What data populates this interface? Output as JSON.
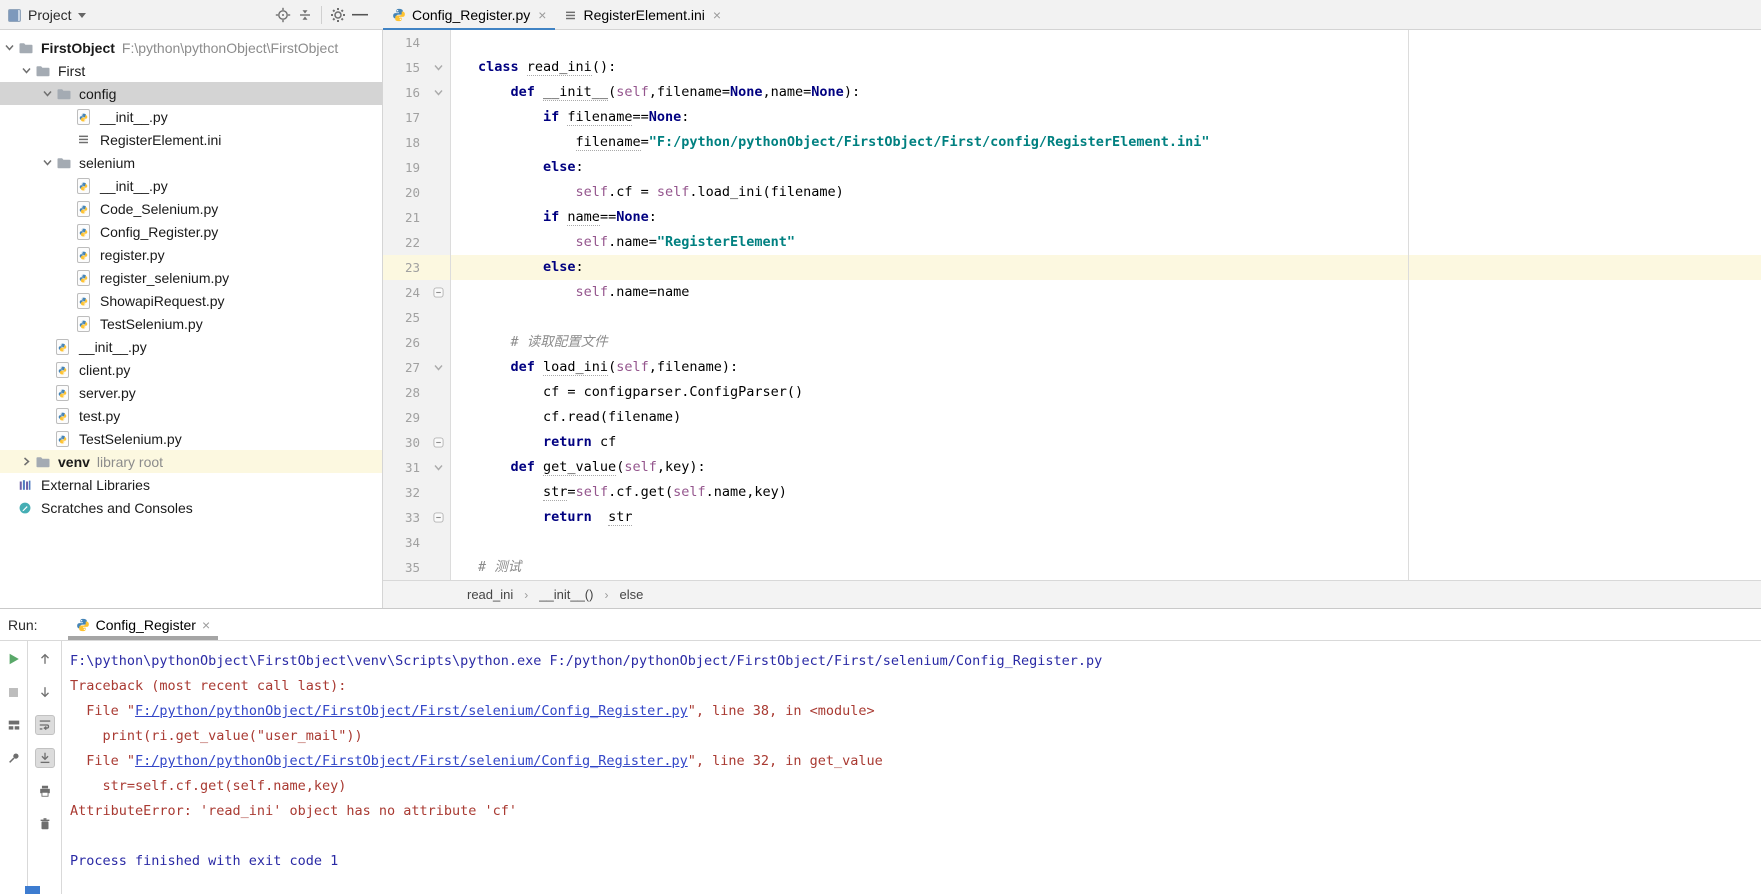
{
  "project_panel": {
    "title": "Project",
    "toolbar": [
      "locate",
      "collapse-all",
      "settings",
      "hide"
    ],
    "tree": [
      {
        "label": "FirstObject",
        "note": "F:\\python\\pythonObject\\FirstObject",
        "type": "folder",
        "depth": 0,
        "state": "expanded",
        "bold": true
      },
      {
        "label": "First",
        "type": "folder",
        "depth": 1,
        "state": "expanded"
      },
      {
        "label": "config",
        "type": "folder",
        "depth": 2,
        "state": "expanded",
        "selected": true
      },
      {
        "label": "__init__.py",
        "type": "python",
        "depth": 3
      },
      {
        "label": "RegisterElement.ini",
        "type": "ini",
        "depth": 3
      },
      {
        "label": "selenium",
        "type": "folder",
        "depth": 2,
        "state": "expanded"
      },
      {
        "label": "__init__.py",
        "type": "python",
        "depth": 3
      },
      {
        "label": "Code_Selenium.py",
        "type": "python",
        "depth": 3
      },
      {
        "label": "Config_Register.py",
        "type": "python",
        "depth": 3
      },
      {
        "label": "register.py",
        "type": "python",
        "depth": 3
      },
      {
        "label": "register_selenium.py",
        "type": "python",
        "depth": 3
      },
      {
        "label": "ShowapiRequest.py",
        "type": "python",
        "depth": 3
      },
      {
        "label": "TestSelenium.py",
        "type": "python",
        "depth": 3
      },
      {
        "label": "__init__.py",
        "type": "python",
        "depth": 2
      },
      {
        "label": "client.py",
        "type": "python",
        "depth": 2
      },
      {
        "label": "server.py",
        "type": "python",
        "depth": 2
      },
      {
        "label": "test.py",
        "type": "python",
        "depth": 2
      },
      {
        "label": "TestSelenium.py",
        "type": "python",
        "depth": 2
      },
      {
        "label": "venv",
        "note": "library root",
        "type": "folder",
        "depth": 1,
        "state": "collapsed",
        "bold": true,
        "highlight": true
      },
      {
        "label": "External Libraries",
        "type": "libraries",
        "depth": 0
      },
      {
        "label": "Scratches and Consoles",
        "type": "scratches",
        "depth": 0
      }
    ]
  },
  "editor": {
    "tabs": [
      {
        "label": "Config_Register.py",
        "icon": "python",
        "active": true
      },
      {
        "label": "RegisterElement.ini",
        "icon": "ini",
        "active": false
      }
    ],
    "breadcrumbs": [
      "read_ini",
      "__init__()",
      "else"
    ],
    "lines": [
      {
        "n": 14,
        "segs": []
      },
      {
        "n": 15,
        "fold": "open",
        "segs": [
          {
            "t": "class ",
            "c": "kw"
          },
          {
            "t": "read_ini",
            "c": "pl u"
          },
          {
            "t": "():",
            "c": "pl"
          }
        ]
      },
      {
        "n": 16,
        "fold": "open",
        "segs": [
          {
            "t": "    ",
            "c": "pl"
          },
          {
            "t": "def ",
            "c": "kw"
          },
          {
            "t": "__init__",
            "c": "pl u"
          },
          {
            "t": "(",
            "c": "pl"
          },
          {
            "t": "self",
            "c": "self"
          },
          {
            "t": ",filename=",
            "c": "pl"
          },
          {
            "t": "None",
            "c": "kw"
          },
          {
            "t": ",name=",
            "c": "pl"
          },
          {
            "t": "None",
            "c": "kw"
          },
          {
            "t": "):",
            "c": "pl"
          }
        ]
      },
      {
        "n": 17,
        "segs": [
          {
            "t": "        ",
            "c": "pl"
          },
          {
            "t": "if ",
            "c": "kw"
          },
          {
            "t": "filename",
            "c": "pl u"
          },
          {
            "t": "==",
            "c": "pl"
          },
          {
            "t": "None",
            "c": "kw"
          },
          {
            "t": ":",
            "c": "pl"
          }
        ]
      },
      {
        "n": 18,
        "segs": [
          {
            "t": "            ",
            "c": "pl"
          },
          {
            "t": "filename",
            "c": "pl u"
          },
          {
            "t": "=",
            "c": "pl"
          },
          {
            "t": "\"F:/python/pythonObject/FirstObject/First/config/RegisterElement.ini\"",
            "c": "str"
          }
        ]
      },
      {
        "n": 19,
        "segs": [
          {
            "t": "        ",
            "c": "pl"
          },
          {
            "t": "else",
            "c": "kw"
          },
          {
            "t": ":",
            "c": "pl"
          }
        ]
      },
      {
        "n": 20,
        "segs": [
          {
            "t": "            ",
            "c": "pl"
          },
          {
            "t": "self",
            "c": "self"
          },
          {
            "t": ".cf = ",
            "c": "pl"
          },
          {
            "t": "self",
            "c": "self"
          },
          {
            "t": ".load_ini(filename)",
            "c": "pl"
          }
        ]
      },
      {
        "n": 21,
        "segs": [
          {
            "t": "        ",
            "c": "pl"
          },
          {
            "t": "if ",
            "c": "kw"
          },
          {
            "t": "name",
            "c": "pl u"
          },
          {
            "t": "==",
            "c": "pl"
          },
          {
            "t": "None",
            "c": "kw"
          },
          {
            "t": ":",
            "c": "pl"
          }
        ]
      },
      {
        "n": 22,
        "segs": [
          {
            "t": "            ",
            "c": "pl"
          },
          {
            "t": "self",
            "c": "self"
          },
          {
            "t": ".name=",
            "c": "pl"
          },
          {
            "t": "\"RegisterElement\"",
            "c": "str"
          }
        ]
      },
      {
        "n": 23,
        "current": true,
        "segs": [
          {
            "t": "        ",
            "c": "pl"
          },
          {
            "t": "else",
            "c": "kw"
          },
          {
            "t": ":",
            "c": "pl"
          }
        ]
      },
      {
        "n": 24,
        "fold": "end",
        "segs": [
          {
            "t": "            ",
            "c": "pl"
          },
          {
            "t": "self",
            "c": "self"
          },
          {
            "t": ".name=name",
            "c": "pl"
          }
        ]
      },
      {
        "n": 25,
        "segs": []
      },
      {
        "n": 26,
        "segs": [
          {
            "t": "    ",
            "c": "pl"
          },
          {
            "t": "# 读取配置文件",
            "c": "com"
          }
        ]
      },
      {
        "n": 27,
        "fold": "open",
        "segs": [
          {
            "t": "    ",
            "c": "pl"
          },
          {
            "t": "def ",
            "c": "kw"
          },
          {
            "t": "load_ini",
            "c": "pl u"
          },
          {
            "t": "(",
            "c": "pl"
          },
          {
            "t": "self",
            "c": "self"
          },
          {
            "t": ",filename):",
            "c": "pl"
          }
        ]
      },
      {
        "n": 28,
        "segs": [
          {
            "t": "        cf = configparser.ConfigParser()",
            "c": "pl"
          }
        ]
      },
      {
        "n": 29,
        "segs": [
          {
            "t": "        cf.read(filename)",
            "c": "pl"
          }
        ]
      },
      {
        "n": 30,
        "fold": "end",
        "segs": [
          {
            "t": "        ",
            "c": "pl"
          },
          {
            "t": "return ",
            "c": "kw"
          },
          {
            "t": "cf",
            "c": "pl"
          }
        ]
      },
      {
        "n": 31,
        "fold": "open",
        "segs": [
          {
            "t": "    ",
            "c": "pl"
          },
          {
            "t": "def ",
            "c": "kw"
          },
          {
            "t": "get_value",
            "c": "pl u"
          },
          {
            "t": "(",
            "c": "pl"
          },
          {
            "t": "self",
            "c": "self"
          },
          {
            "t": ",key):",
            "c": "pl"
          }
        ]
      },
      {
        "n": 32,
        "segs": [
          {
            "t": "        ",
            "c": "pl"
          },
          {
            "t": "str",
            "c": "pl u"
          },
          {
            "t": "=",
            "c": "pl"
          },
          {
            "t": "self",
            "c": "self"
          },
          {
            "t": ".cf.get(",
            "c": "pl"
          },
          {
            "t": "self",
            "c": "self"
          },
          {
            "t": ".name,key)",
            "c": "pl"
          }
        ]
      },
      {
        "n": 33,
        "fold": "end",
        "segs": [
          {
            "t": "        ",
            "c": "pl"
          },
          {
            "t": "return",
            "c": "kw"
          },
          {
            "t": "  ",
            "c": "pl"
          },
          {
            "t": "str",
            "c": "pl u"
          }
        ]
      },
      {
        "n": 34,
        "segs": []
      },
      {
        "n": 35,
        "segs": [
          {
            "t": "# 测试",
            "c": "com"
          }
        ]
      }
    ]
  },
  "run_panel": {
    "label": "Run:",
    "tab": {
      "label": "Config_Register",
      "icon": "python"
    },
    "left_toolbar": [
      "rerun",
      "stop",
      "restore-layout",
      "pin"
    ],
    "gutter_toolbar": [
      {
        "name": "up"
      },
      {
        "name": "down"
      },
      {
        "name": "soft-wrap",
        "toggled": true
      },
      {
        "name": "scroll-to-end",
        "toggled": true
      },
      {
        "name": "print"
      },
      {
        "name": "clear"
      }
    ],
    "console": [
      {
        "segs": [
          {
            "t": "F:\\python\\pythonObject\\FirstObject\\venv\\Scripts\\python.exe F:/python/pythonObject/FirstObject/First/selenium/Config_Register.py",
            "c": "out"
          }
        ]
      },
      {
        "segs": [
          {
            "t": "Traceback (most recent call last):",
            "c": "err"
          }
        ]
      },
      {
        "segs": [
          {
            "t": "  File \"",
            "c": "err"
          },
          {
            "t": "F:/python/pythonObject/FirstObject/First/selenium/Config_Register.py",
            "c": "lnk"
          },
          {
            "t": "\", line 38, in <module>",
            "c": "err"
          }
        ]
      },
      {
        "segs": [
          {
            "t": "    print(ri.get_value(\"user_mail\"))",
            "c": "err"
          }
        ]
      },
      {
        "segs": [
          {
            "t": "  File \"",
            "c": "err"
          },
          {
            "t": "F:/python/pythonObject/FirstObject/First/selenium/Config_Register.py",
            "c": "lnk"
          },
          {
            "t": "\", line 32, in get_value",
            "c": "err"
          }
        ]
      },
      {
        "segs": [
          {
            "t": "    str=self.cf.get(self.name,key)",
            "c": "err"
          }
        ]
      },
      {
        "segs": [
          {
            "t": "AttributeError: 'read_ini' object has no attribute 'cf'",
            "c": "err"
          }
        ]
      },
      {
        "segs": []
      },
      {
        "segs": [
          {
            "t": "Process finished with exit code 1",
            "c": "out"
          }
        ]
      }
    ]
  },
  "colors": {
    "active_tab_underline": "#4083C4",
    "run_tab_underline": "#A5A5A5",
    "current_line": "#FCF8E0",
    "selection_gray": "#D4D4D4",
    "keyword": "#000080",
    "string": "#008080",
    "self_param": "#94558D",
    "comment": "#8C8C8C",
    "stderr_red": "#A93A32",
    "stdout_blue": "#2A2AA5",
    "link_blue": "#3246C8"
  }
}
